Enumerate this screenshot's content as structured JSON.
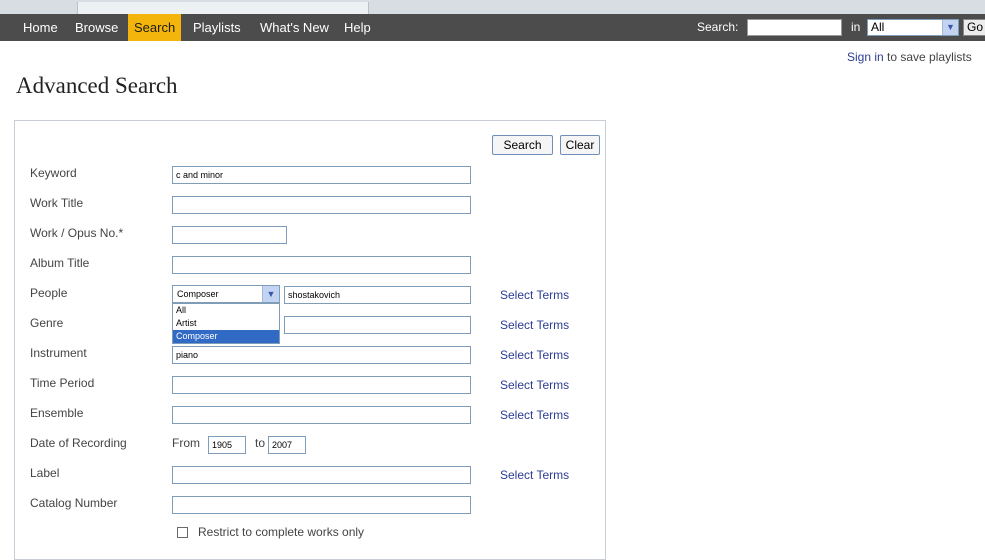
{
  "nav": {
    "tabs": [
      {
        "label": "Home"
      },
      {
        "label": "Browse"
      },
      {
        "label": "Search",
        "active": true
      },
      {
        "label": "Playlists"
      },
      {
        "label": "What's New"
      },
      {
        "label": "Help"
      }
    ],
    "search_label": "Search:",
    "search_value": "",
    "in_label": "in",
    "scope_value": "All",
    "go_label": "Go"
  },
  "signin": {
    "link": "Sign in",
    "text": " to save playlists"
  },
  "page_title": "Advanced Search",
  "form": {
    "search_button": "Search",
    "clear_button": "Clear",
    "keyword": {
      "label": "Keyword",
      "value": "c and minor"
    },
    "work_title": {
      "label": "Work Title",
      "value": ""
    },
    "work_opus": {
      "label": "Work / Opus No.*",
      "value": ""
    },
    "album_title": {
      "label": "Album Title",
      "value": ""
    },
    "people": {
      "label": "People",
      "role_selected": "Composer",
      "role_options": [
        "All",
        "Artist",
        "Composer"
      ],
      "value": "shostakovich"
    },
    "genre": {
      "label": "Genre",
      "value": ""
    },
    "instrument": {
      "label": "Instrument",
      "value": "piano"
    },
    "time_period": {
      "label": "Time Period",
      "value": ""
    },
    "ensemble": {
      "label": "Ensemble",
      "value": ""
    },
    "date_of_recording": {
      "label": "Date of Recording",
      "from_label": "From",
      "from_value": "1905",
      "to_label": "to",
      "to_value": "2007"
    },
    "label": {
      "label": "Label",
      "value": ""
    },
    "catalog_number": {
      "label": "Catalog Number",
      "value": ""
    },
    "select_terms": "Select Terms",
    "restrict_label": "Restrict to complete works only",
    "restrict_checked": false
  }
}
